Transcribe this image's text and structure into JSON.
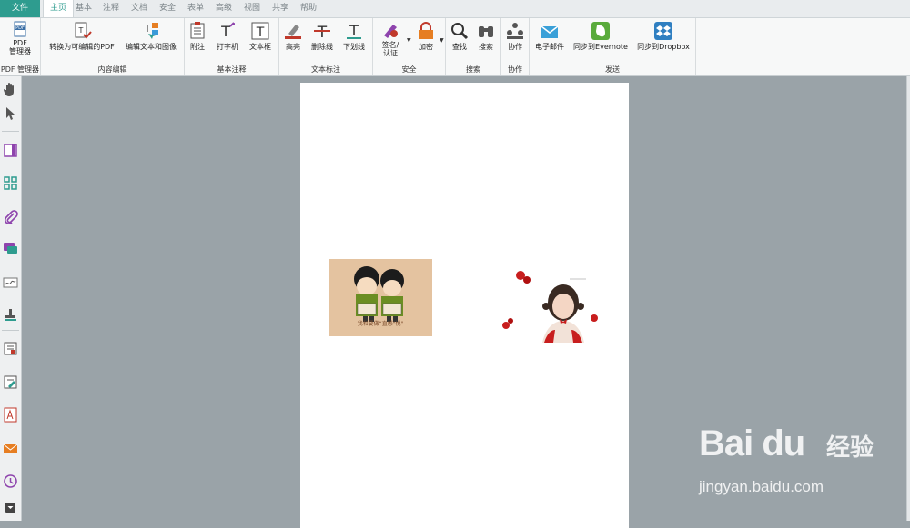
{
  "tabs": {
    "file": "文件",
    "items": [
      "主页",
      "基本",
      "注释",
      "文档",
      "安全",
      "表单",
      "高级",
      "视图",
      "共享",
      "帮助"
    ]
  },
  "ribbon": {
    "pdf_manager": {
      "btn1": "PDF",
      "btn2": "管理器",
      "label": "PDF 管理器"
    },
    "content_edit": {
      "convert": "转换为可编辑的PDF",
      "edit_text_image": "编辑文本和图像",
      "label": "内容编辑"
    },
    "basic_annot": {
      "note": "附注",
      "typewriter": "打字机",
      "textbox": "文本框",
      "label": "基本注释"
    },
    "text_markup": {
      "highlight": "高亮",
      "strikeout": "删除线",
      "underline": "下划线",
      "label": "文本标注"
    },
    "security": {
      "sign1": "签名/",
      "sign2": "认证",
      "encrypt": "加密",
      "label": "安全"
    },
    "search": {
      "find": "查找",
      "search": "搜索",
      "label": "搜索"
    },
    "collab": {
      "collab": "协作",
      "label": "协作"
    },
    "send": {
      "email": "电子邮件",
      "evernote": "同步到Evernote",
      "dropbox": "同步到Dropbox",
      "label": "发送"
    }
  },
  "document": {
    "image1_caption": "我和要做“直感\"悦\""
  },
  "watermark": {
    "logo": "Bai du",
    "cn": "经验",
    "url": "jingyan.baidu.com"
  },
  "colors": {
    "accent": "#2e9c8f",
    "workspace": "#9aa3a8"
  }
}
